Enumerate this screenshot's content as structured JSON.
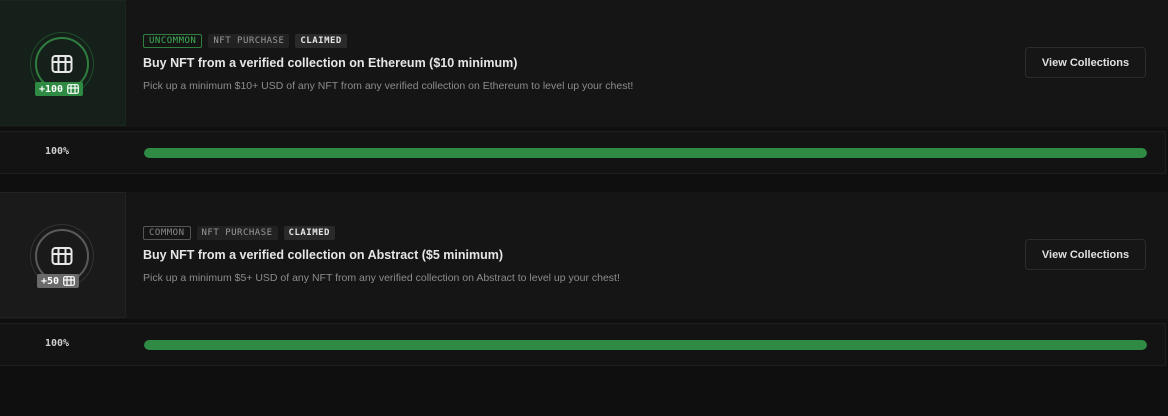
{
  "quests": [
    {
      "rarity": "uncommon",
      "tags": {
        "rarity": "UNCOMMON",
        "type": "NFT PURCHASE",
        "status": "CLAIMED"
      },
      "reward": "+100",
      "title": "Buy NFT from a verified collection on Ethereum ($10 minimum)",
      "description": "Pick up a minimum $10+ USD of any NFT from any verified collection on Ethereum to level up your chest!",
      "button_label": "View Collections",
      "progress_label": "100%",
      "progress_fraction": 1.0
    },
    {
      "rarity": "common",
      "tags": {
        "rarity": "COMMON",
        "type": "NFT PURCHASE",
        "status": "CLAIMED"
      },
      "reward": "+50",
      "title": "Buy NFT from a verified collection on Abstract ($5 minimum)",
      "description": "Pick up a minimum $5+ USD of any NFT from any verified collection on Abstract to level up your chest!",
      "button_label": "View Collections",
      "progress_label": "100%",
      "progress_fraction": 1.0
    }
  ],
  "colors": {
    "accent_green": "#2f8a44",
    "uncommon_text": "#3fae55",
    "common_badge": "#6a6a6a"
  },
  "icons": [
    "chest-icon",
    "chest-small-icon"
  ]
}
